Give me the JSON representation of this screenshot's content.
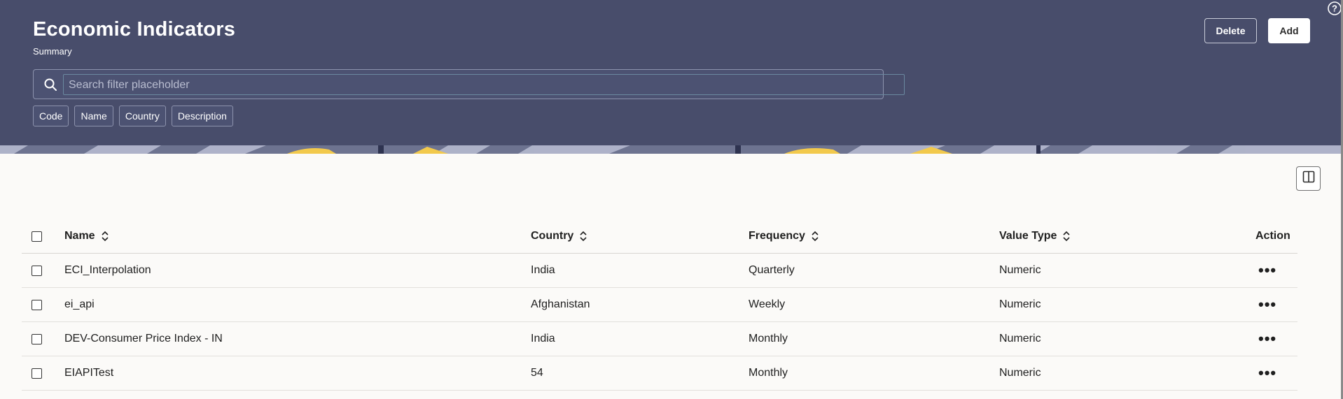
{
  "header": {
    "title": "Economic Indicators",
    "subtitle": "Summary",
    "search": {
      "placeholder": "Search filter placeholder",
      "value": ""
    },
    "filter_chips": [
      "Code",
      "Name",
      "Country",
      "Description"
    ],
    "delete_label": "Delete",
    "add_label": "Add"
  },
  "table": {
    "columns": {
      "name": "Name",
      "country": "Country",
      "frequency": "Frequency",
      "value_type": "Value Type",
      "action": "Action"
    },
    "rows": [
      {
        "name": "ECI_Interpolation",
        "country": "India",
        "frequency": "Quarterly",
        "value_type": "Numeric"
      },
      {
        "name": "ei_api",
        "country": "Afghanistan",
        "frequency": "Weekly",
        "value_type": "Numeric"
      },
      {
        "name": "DEV-Consumer Price Index - IN",
        "country": "India",
        "frequency": "Monthly",
        "value_type": "Numeric"
      },
      {
        "name": "EIAPITest",
        "country": "54",
        "frequency": "Monthly",
        "value_type": "Numeric"
      }
    ],
    "action_glyph": "•••"
  },
  "colors": {
    "header_bg": "#484d6b",
    "content_bg": "#fbfaf8",
    "accent_yellow": "#f2c94c"
  }
}
